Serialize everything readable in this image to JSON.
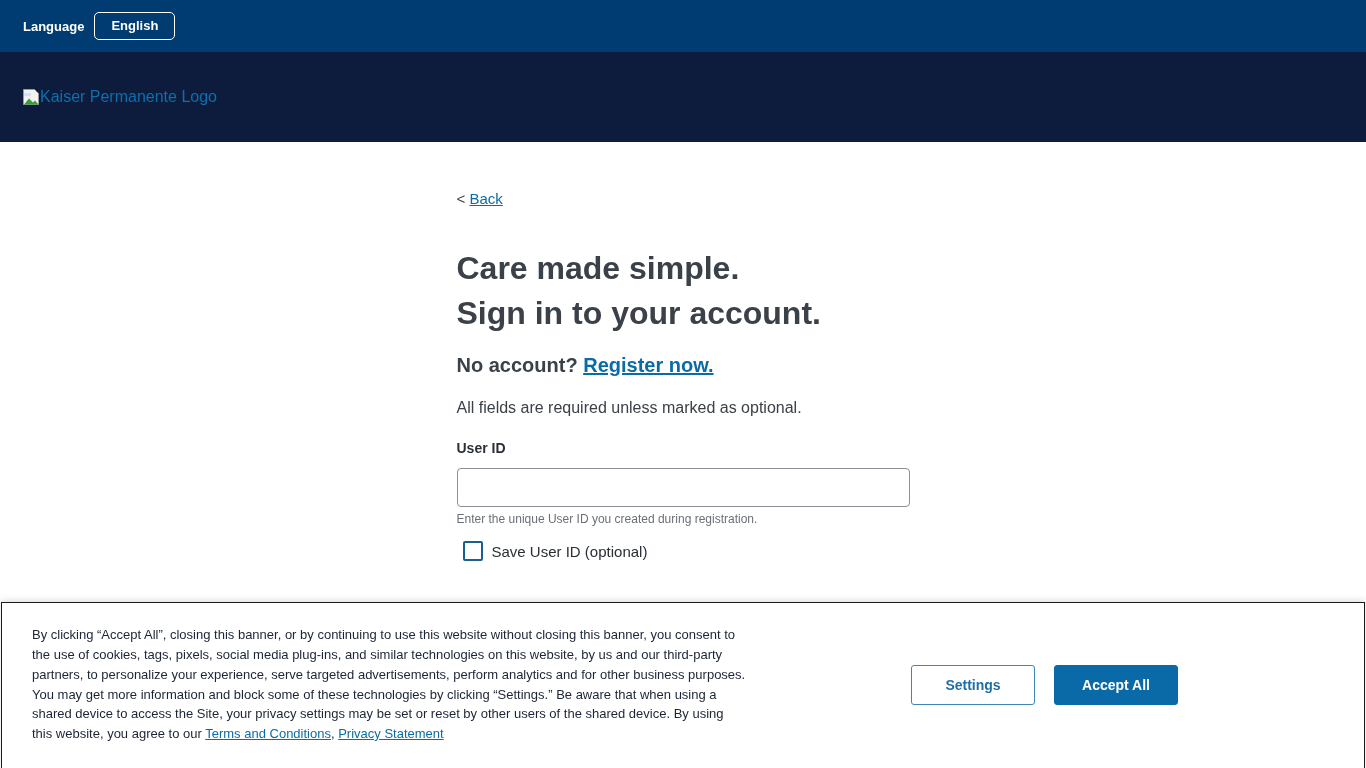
{
  "top_bar": {
    "language_label": "Language",
    "language_button": "English"
  },
  "header": {
    "logo_alt_text": "Kaiser Permanente Logo"
  },
  "back_link": {
    "prefix": "<",
    "label": "Back"
  },
  "heading": [
    "Care made simple.",
    "Sign in to your account."
  ],
  "register_prompt": {
    "text": "No account?",
    "link": "Register now."
  },
  "required_note": "All fields are required unless marked as optional.",
  "user_id_field": {
    "label": "User ID",
    "hint": "Enter the unique User ID you created during registration."
  },
  "save_user_id": {
    "label": "Save User ID (optional)",
    "checked": false
  },
  "cookie_banner": {
    "message": "By clicking “Accept All”, closing this banner, or by continuing to use this website without closing this banner, you consent to the use of cookies, tags, pixels, social media plug-ins, and similar technologies on this website, by us and our third-party partners, to personalize your experience, serve targeted advertisements, perform analytics and for other business purposes. You may get more information and block some of these technologies by clicking “Settings.” Be aware that when using a shared device to access the Site, your privacy settings may be set or reset by other users of the shared device. By using this website, you agree to our",
    "links": [
      "Terms and Conditions",
      "Privacy Statement"
    ],
    "link_separator": ", ",
    "buttons": [
      {
        "label": "Settings",
        "kind": "secondary"
      },
      {
        "label": "Accept All",
        "kind": "primary"
      }
    ]
  }
}
